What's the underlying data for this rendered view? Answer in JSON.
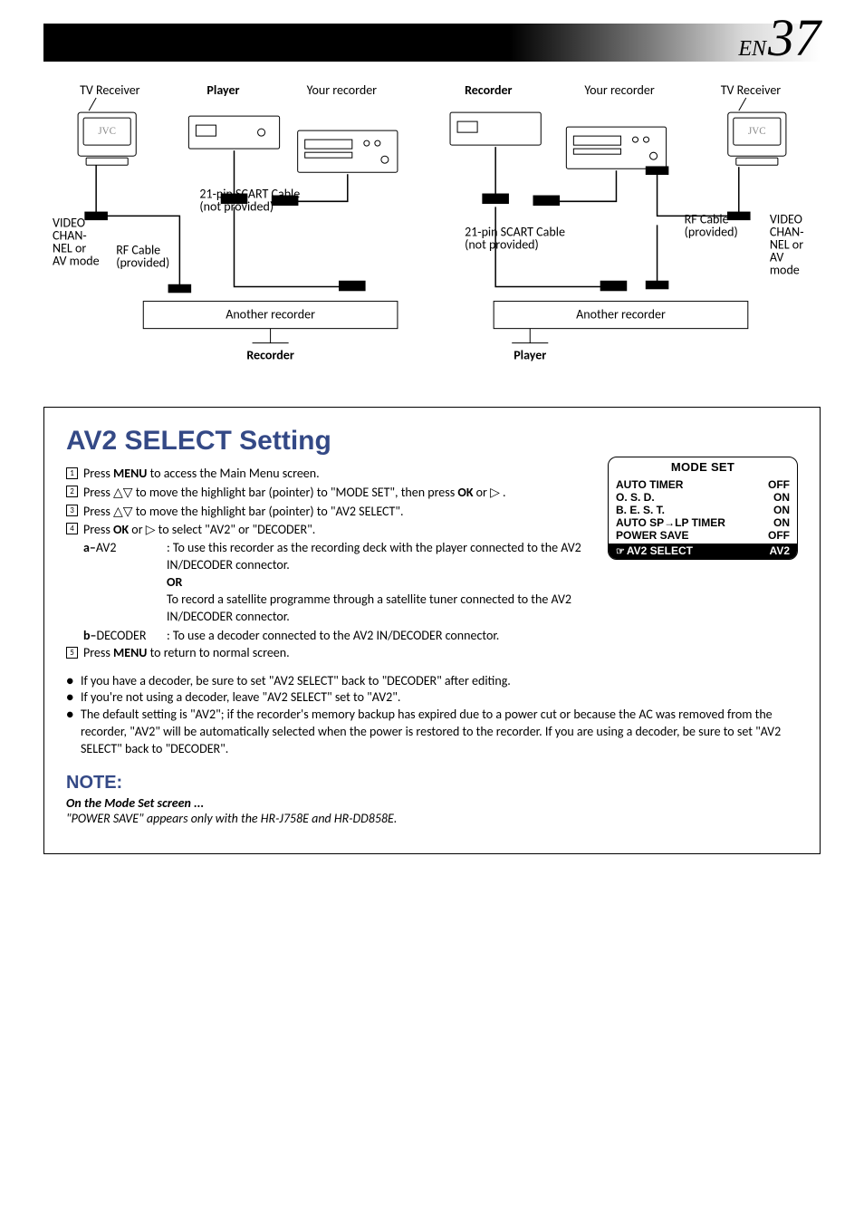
{
  "page": {
    "lang": "EN",
    "number": "37"
  },
  "diagrams": {
    "left": {
      "tv_receiver": "TV Receiver",
      "player": "Player",
      "your_recorder": "Your recorder",
      "video_mode": "VIDEO\nCHANNEL or\nAV mode",
      "rf_cable": "RF Cable\n(provided)",
      "scart": "21-pin SCART Cable\n(not provided)",
      "another_recorder": "Another recorder",
      "recorder": "Recorder"
    },
    "right": {
      "recorder": "Recorder",
      "your_recorder": "Your recorder",
      "tv_receiver": "TV Receiver",
      "scart": "21-pin SCART Cable\n(not provided)",
      "rf_cable": "RF Cable\n(provided)",
      "video_mode": "VIDEO\nCHANNEL or\nAV\nmode",
      "another_recorder": "Another recorder",
      "player": "Player"
    }
  },
  "section": {
    "title": "AV2 SELECT Setting",
    "steps": {
      "s1_pre": "Press ",
      "s1_menu": "MENU",
      "s1_post": " to access the Main Menu screen.",
      "s2_pre": "Press ",
      "s2_tri": "△▽",
      "s2_mid": " to move the highlight bar (pointer) to \"MODE SET\", then press ",
      "s2_ok": "OK",
      "s2_or": " or ",
      "s2_r": "▷",
      "s2_end": " .",
      "s3_pre": "Press ",
      "s3_tri": "△▽",
      "s3_post": " to move the highlight bar (pointer) to \"AV2 SELECT\".",
      "s4_pre": "Press ",
      "s4_ok": "OK",
      "s4_or": " or ",
      "s4_r": "▷",
      "s4_post": " to select \"AV2\" or \"DECODER\".",
      "a_label": "a–",
      "a_name": "AV2",
      "a_body1": ": To use this recorder as the recording deck with the player connected to the AV2 IN/DECODER connector.",
      "or": "OR",
      "a_body2": "To record a satellite programme through a satellite tuner connected to the AV2 IN/DECODER connector.",
      "b_label": "b–",
      "b_name": "DECODER ",
      "b_body": ": To use a decoder connected to the AV2 IN/DECODER connector.",
      "s5_pre": "Press ",
      "s5_menu": "MENU",
      "s5_post": " to return to normal screen."
    },
    "bullets": {
      "b1": "If you have a decoder, be sure to set \"AV2 SELECT\" back to \"DECODER\" after editing.",
      "b2": "If you're not using a decoder, leave \"AV2 SELECT\" set to \"AV2\".",
      "b3": "The default setting is \"AV2\"; if the recorder's memory backup has expired due to a power cut or because the AC was removed from the recorder, \"AV2\" will be automatically selected when the power is restored to the recorder. If you are using a decoder, be sure to set \"AV2 SELECT\" back to \"DECODER\"."
    },
    "note": {
      "heading": "NOTE:",
      "sub": "On the Mode Set screen ...",
      "body": "\"POWER SAVE\" appears only with the HR-J758E and HR-DD858E."
    }
  },
  "osd": {
    "title": "MODE SET",
    "rows": [
      {
        "l": "AUTO TIMER",
        "r": "OFF"
      },
      {
        "l": "O. S. D.",
        "r": "ON"
      },
      {
        "l": "B. E. S. T.",
        "r": "ON"
      },
      {
        "l": "AUTO SP→LP TIMER",
        "r": "ON"
      },
      {
        "l": "POWER SAVE",
        "r": "OFF"
      }
    ],
    "sel": {
      "hand": "☞",
      "l": "AV2 SELECT",
      "r": "AV2"
    }
  }
}
